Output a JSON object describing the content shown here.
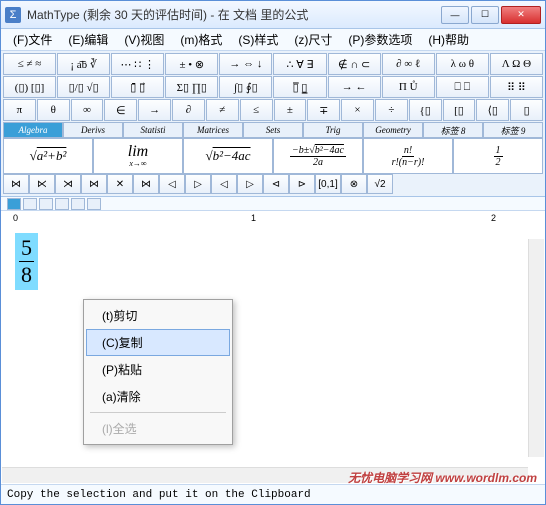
{
  "window": {
    "icon": "Σ",
    "title": "MathType (剩余 30 天的评估时间) - 在 文档 里的公式"
  },
  "menu": [
    "(F)文件",
    "(E)编辑",
    "(V)视图",
    "(m)格式",
    "(S)样式",
    "(z)尺寸",
    "(P)参数选项",
    "(H)帮助"
  ],
  "toolbar": {
    "row1": [
      "≤ ≠ ≈",
      "¡ a͡b ∛",
      "⋯ ∷ ⋮",
      "± • ⊗",
      "→ ⇔ ↓",
      "∴ ∀ ∃",
      "∉ ∩ ⊂",
      "∂ ∞ ℓ",
      "λ ω θ",
      "Λ Ω Θ"
    ],
    "row2": [
      "(▯) [▯]",
      "▯/▯ √▯",
      "▯̄ ▯⃗",
      "Σ▯ ∏▯",
      "∫▯ ∮▯",
      "▯̅ ▯̲",
      "→ ←",
      "Π Ů",
      "⎕ ⎕",
      "⠿ ⠿"
    ],
    "row3": [
      "π",
      "θ",
      "∞",
      "∈",
      "→",
      "∂",
      "≠",
      "≤",
      "±",
      "∓",
      "×",
      "÷",
      "{▯",
      "[▯",
      "⟨▯",
      "▯"
    ],
    "tabs": [
      "Algebra",
      "Derivs",
      "Statisti",
      "Matrices",
      "Sets",
      "Trig",
      "Geometry",
      "标签 8",
      "标签 9"
    ],
    "formulas_tex": [
      "\\sqrt{a^2+b^2}",
      "\\lim_{x\\to\\infty}",
      "\\sqrt{b^2-4ac}",
      "\\frac{-b\\pm\\sqrt{b^2-4ac}}{2a}",
      "\\frac{n!}{r!(n-r)!}",
      "\\frac{1}{2}"
    ],
    "smallrow": [
      "⋈",
      "⋉",
      "⋊",
      "⋈",
      "✕",
      "⋈",
      "◁",
      "▷",
      "◁",
      "▷",
      "⊲",
      "⊳",
      "[0,1]",
      "⊗",
      "√2",
      ""
    ]
  },
  "ruler": {
    "marks": [
      "0",
      "1",
      "2"
    ]
  },
  "editor": {
    "fraction": {
      "num": "5",
      "den": "8"
    }
  },
  "context_menu": [
    {
      "label": "(t)剪切",
      "enabled": true
    },
    {
      "label": "(C)复制",
      "enabled": true,
      "hover": true
    },
    {
      "label": "(P)粘贴",
      "enabled": true
    },
    {
      "label": "(a)清除",
      "enabled": true
    },
    {
      "sep": true
    },
    {
      "label": "(l)全选",
      "enabled": false
    }
  ],
  "statusbar": "Copy the selection and put it on the Clipboard",
  "watermark": "无忧电脑学习网 www.wordlm.com"
}
